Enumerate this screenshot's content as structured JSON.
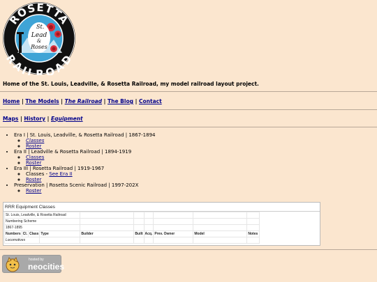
{
  "logo": {
    "top_word": "ROSETTA",
    "bottom_word": "RAILROAD",
    "center_line1": "St.",
    "center_line2": "Lead",
    "center_line3": "&",
    "center_line4": "Roses",
    "colors": {
      "ring": "#111111",
      "center": "#3fa4d6",
      "text": "#ffffff",
      "rose": "#d9303c"
    }
  },
  "intro": "Home of the St. Louis, Leadville, & Rosetta Railroad, my model railroad layout project.",
  "nav_primary": {
    "sep": "|",
    "items": [
      {
        "label": "Home"
      },
      {
        "label": "The Models"
      },
      {
        "label": "The Railroad"
      },
      {
        "label": "The Blog"
      },
      {
        "label": "Contact"
      }
    ]
  },
  "nav_secondary": {
    "items": [
      {
        "label": "Maps"
      },
      {
        "label": "History"
      },
      {
        "label": "Equipment"
      }
    ]
  },
  "eras": [
    {
      "title": "Era I | St. Louis, Leadville, & Rosetta Railroad | 1867-1894",
      "links": [
        "Classes",
        "Roster"
      ]
    },
    {
      "title": "Era II | Leadville & Rosetta Railroad | 1894-1919",
      "links": [
        "Classes",
        "Roster"
      ]
    },
    {
      "title": "Era III | Rosetta Railroad | 1919-1967",
      "classes_prefix": "Classes - ",
      "classes_link": "See Era II",
      "links": [
        "Roster"
      ]
    },
    {
      "title": "Preservation | Rosetta Scenic Railroad | 1997-202X",
      "links": [
        "Roster"
      ]
    }
  ],
  "sheet": {
    "title": "RRR Equipment Classes",
    "rows": [
      "St. Louis, Leadville, & Rosetta Railroad",
      "Numbering Scheme",
      "1867-1895"
    ],
    "headers": [
      "Numbers",
      "Cl.",
      "Class",
      "Type",
      "Builder",
      "Built",
      "Acq.",
      "Prev. Owner",
      "Model",
      "Notes"
    ],
    "section": "Locomotives"
  },
  "badge": {
    "line1": "hosted by",
    "line2": "neocities"
  }
}
